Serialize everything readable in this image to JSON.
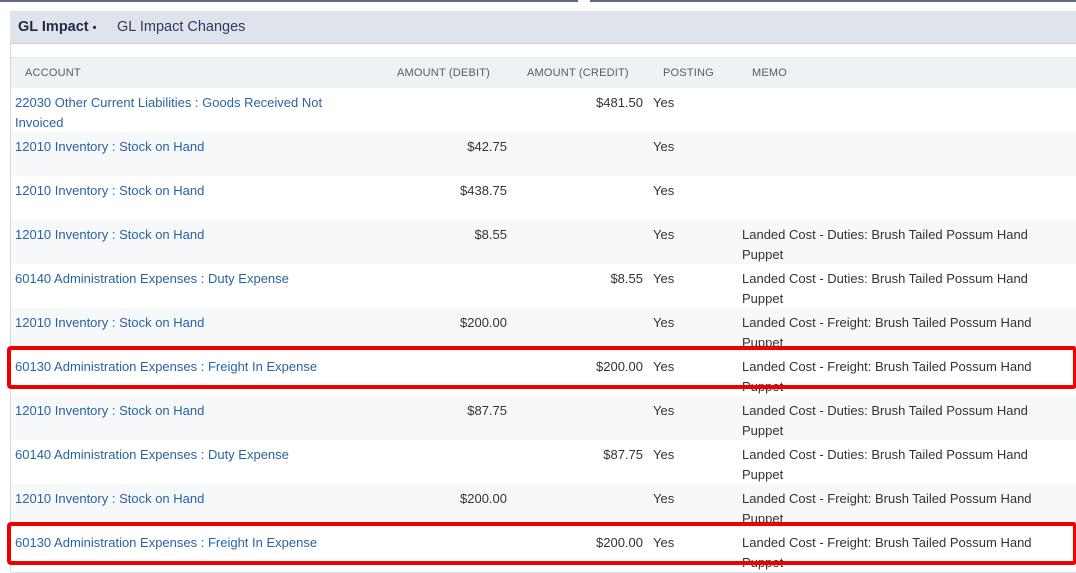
{
  "subtabs": [
    {
      "label": "GL Impact",
      "dot": "•"
    },
    {
      "label": "GL Impact Changes"
    }
  ],
  "columns": {
    "account": "ACCOUNT",
    "debit": "AMOUNT (DEBIT)",
    "credit": "AMOUNT (CREDIT)",
    "posting": "POSTING",
    "memo": "MEMO"
  },
  "rows": [
    {
      "account": "22030 Other Current Liabilities : Goods Received Not Invoiced",
      "debit": "",
      "credit": "$481.50",
      "posting": "Yes",
      "memo": ""
    },
    {
      "account": "12010 Inventory : Stock on Hand",
      "debit": "$42.75",
      "credit": "",
      "posting": "Yes",
      "memo": ""
    },
    {
      "account": "12010 Inventory : Stock on Hand",
      "debit": "$438.75",
      "credit": "",
      "posting": "Yes",
      "memo": ""
    },
    {
      "account": "12010 Inventory : Stock on Hand",
      "debit": "$8.55",
      "credit": "",
      "posting": "Yes",
      "memo": "Landed Cost - Duties: Brush Tailed Possum Hand Puppet"
    },
    {
      "account": "60140 Administration Expenses : Duty Expense",
      "debit": "",
      "credit": "$8.55",
      "posting": "Yes",
      "memo": "Landed Cost - Duties: Brush Tailed Possum Hand Puppet"
    },
    {
      "account": "12010 Inventory : Stock on Hand",
      "debit": "$200.00",
      "credit": "",
      "posting": "Yes",
      "memo": "Landed Cost - Freight: Brush Tailed Possum Hand Puppet"
    },
    {
      "account": "60130 Administration Expenses : Freight In Expense",
      "debit": "",
      "credit": "$200.00",
      "posting": "Yes",
      "memo": "Landed Cost - Freight: Brush Tailed Possum Hand Puppet"
    },
    {
      "account": "12010 Inventory : Stock on Hand",
      "debit": "$87.75",
      "credit": "",
      "posting": "Yes",
      "memo": "Landed Cost - Duties: Brush Tailed Possum Hand Puppet"
    },
    {
      "account": "60140 Administration Expenses : Duty Expense",
      "debit": "",
      "credit": "$87.75",
      "posting": "Yes",
      "memo": "Landed Cost - Duties: Brush Tailed Possum Hand Puppet"
    },
    {
      "account": "12010 Inventory : Stock on Hand",
      "debit": "$200.00",
      "credit": "",
      "posting": "Yes",
      "memo": "Landed Cost - Freight: Brush Tailed Possum Hand Puppet"
    },
    {
      "account": "60130 Administration Expenses : Freight In Expense",
      "debit": "",
      "credit": "$200.00",
      "posting": "Yes",
      "memo": "Landed Cost - Freight: Brush Tailed Possum Hand Puppet"
    }
  ],
  "highlight_color": "#ee0000"
}
